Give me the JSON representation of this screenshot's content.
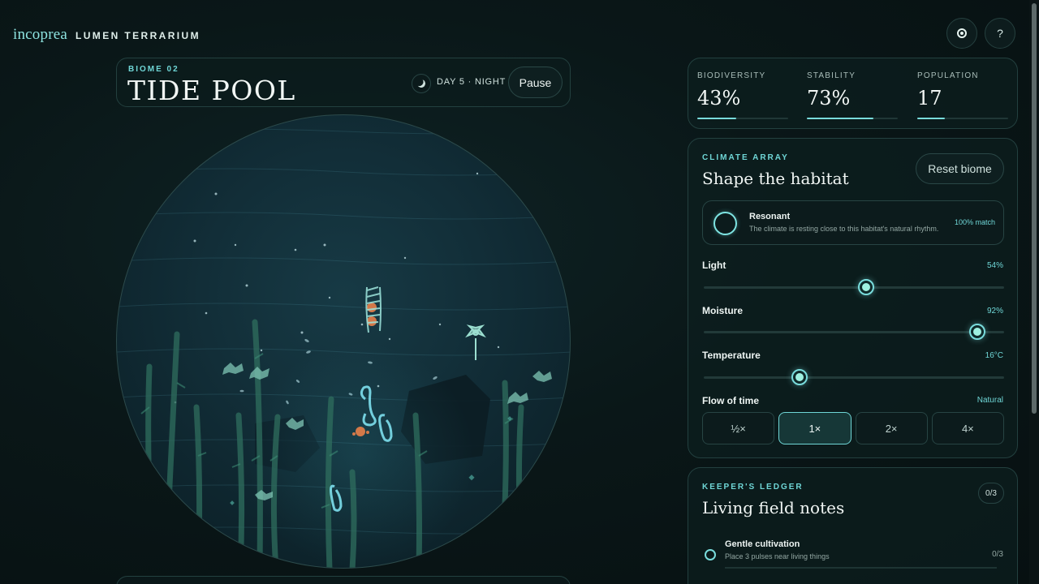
{
  "brand": {
    "logo": "incoprea",
    "name": "LUMEN TERRARIUM"
  },
  "top_actions": {
    "help_label": "?"
  },
  "biome": {
    "kicker": "BIOME 02",
    "title": "TIDE POOL",
    "day_text": "DAY 5 · NIGHT",
    "pause_label": "Pause"
  },
  "stats": [
    {
      "label": "BIODIVERSITY",
      "value": "43%",
      "fill": 0.43
    },
    {
      "label": "STABILITY",
      "value": "73%",
      "fill": 0.73
    },
    {
      "label": "POPULATION",
      "value": "17",
      "fill": 0.3
    }
  ],
  "climate": {
    "kicker": "CLIMATE ARRAY",
    "title": "Shape the habitat",
    "reset_label": "Reset biome",
    "status": {
      "title": "Resonant",
      "description": "The climate is resting close to this habitat's natural rhythm.",
      "match": "100% match"
    },
    "sliders": [
      {
        "label": "Light",
        "value": "54%",
        "level": 0.54
      },
      {
        "label": "Moisture",
        "value": "92%",
        "level": 0.91
      },
      {
        "label": "Temperature",
        "value": "16°C",
        "level": 0.32
      }
    ],
    "time": {
      "label": "Flow of time",
      "value": "Natural",
      "options": [
        "½×",
        "1×",
        "2×",
        "4×"
      ],
      "selected": "1×"
    }
  },
  "ledger": {
    "kicker": "KEEPER'S LEDGER",
    "title": "Living field notes",
    "count": "0/3",
    "tasks": [
      {
        "title": "Gentle cultivation",
        "description": "Place 3 pulses near living things",
        "progress": "0/3"
      }
    ]
  },
  "colors": {
    "accent": "#6fd6d6",
    "background": "#0a1718",
    "coral": "#e8804a",
    "plant": "#2f6e5e"
  }
}
